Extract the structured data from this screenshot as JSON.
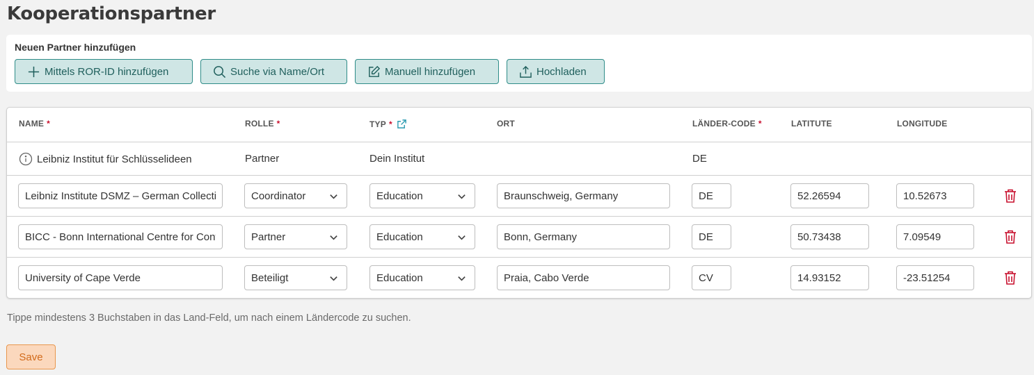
{
  "page": {
    "title": "Kooperationspartner"
  },
  "add_panel": {
    "label": "Neuen Partner hinzufügen",
    "buttons": [
      {
        "label": "Mittels ROR-ID hinzufügen",
        "icon": "plus-icon"
      },
      {
        "label": "Suche via Name/Ort",
        "icon": "search-icon"
      },
      {
        "label": "Manuell hinzufügen",
        "icon": "edit-icon"
      },
      {
        "label": "Hochladen",
        "icon": "upload-icon"
      }
    ]
  },
  "table": {
    "headers": {
      "name": "NAME",
      "rolle": "ROLLE",
      "typ": "TYP",
      "ort": "ORT",
      "laender_code": "LÄNDER-CODE",
      "latitute": "LATITUTE",
      "longitude": "LONGITUDE",
      "required_marker": "*"
    },
    "static_row": {
      "name": "Leibniz Institut für Schlüsselideen",
      "rolle": "Partner",
      "typ": "Dein Institut",
      "ort": "",
      "laender_code": "DE"
    },
    "rows": [
      {
        "name": "Leibniz Institute DSMZ – German Collection of Microorganisms and Cell Cultures",
        "rolle": "Coordinator",
        "typ": "Education",
        "ort": "Braunschweig, Germany",
        "laender_code": "DE",
        "latitude": "52.26594",
        "longitude": "10.52673"
      },
      {
        "name": "BICC - Bonn International Centre for Conflict Studies",
        "rolle": "Partner",
        "typ": "Education",
        "ort": "Bonn, Germany",
        "laender_code": "DE",
        "latitude": "50.73438",
        "longitude": "7.09549"
      },
      {
        "name": "University of Cape Verde",
        "rolle": "Beteiligt",
        "typ": "Education",
        "ort": "Praia, Cabo Verde",
        "laender_code": "CV",
        "latitude": "14.93152",
        "longitude": "-23.51254"
      }
    ]
  },
  "hint": "Tippe mindestens 3 Buchstaben in das Land-Feld, um nach einem Ländercode zu suchen.",
  "save_label": "Save",
  "colors": {
    "accent": "#2e8c88",
    "accent_bg": "#cfe6e5",
    "danger": "#c8102e",
    "save_bg": "#fbd8bd",
    "save_border": "#e8964d"
  }
}
